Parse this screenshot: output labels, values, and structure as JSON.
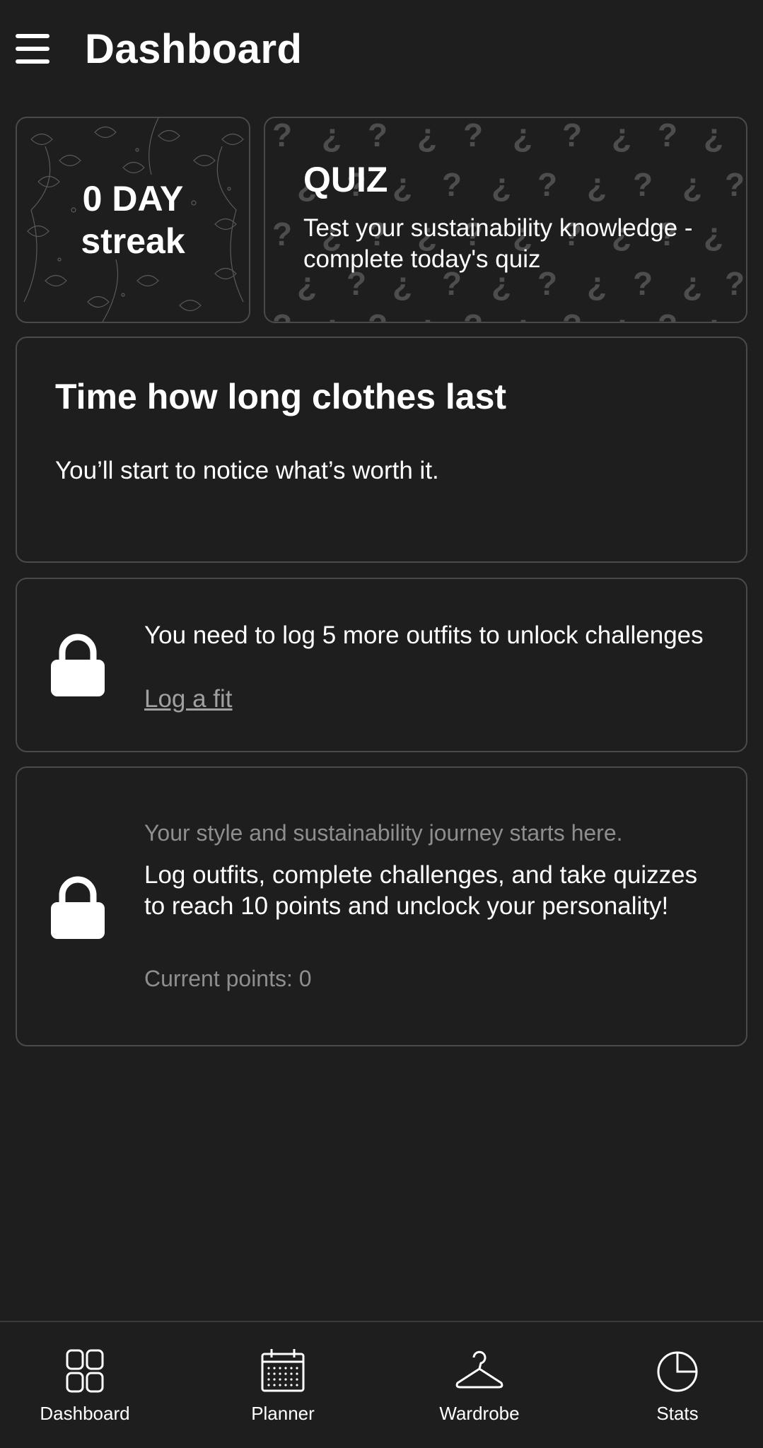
{
  "header": {
    "title": "Dashboard"
  },
  "streak": {
    "count_text": "0 DAY",
    "label": "streak"
  },
  "quiz": {
    "title": "QUIZ",
    "description": "Test your sustainability knowledge - complete today's quiz"
  },
  "time_card": {
    "title": "Time how long clothes last",
    "subtitle": "You’ll start to notice what’s worth it."
  },
  "challenges_lock": {
    "message": "You need to log 5 more outfits to unlock challenges",
    "link": "Log a fit"
  },
  "personality_lock": {
    "subtitle": "Your style and sustainability journey starts here.",
    "message": "Log outfits, complete challenges, and take quizzes to reach 10 points and unclock your personality!",
    "points": "Current points: 0"
  },
  "nav": {
    "items": [
      {
        "label": "Dashboard",
        "icon": "dashboard-icon"
      },
      {
        "label": "Planner",
        "icon": "calendar-icon"
      },
      {
        "label": "Wardrobe",
        "icon": "hanger-icon"
      },
      {
        "label": "Stats",
        "icon": "pie-chart-icon"
      }
    ]
  },
  "colors": {
    "background": "#1e1e1e",
    "border": "#4a4a4a",
    "muted_text": "#8e8e8e",
    "pattern": "#555555"
  }
}
